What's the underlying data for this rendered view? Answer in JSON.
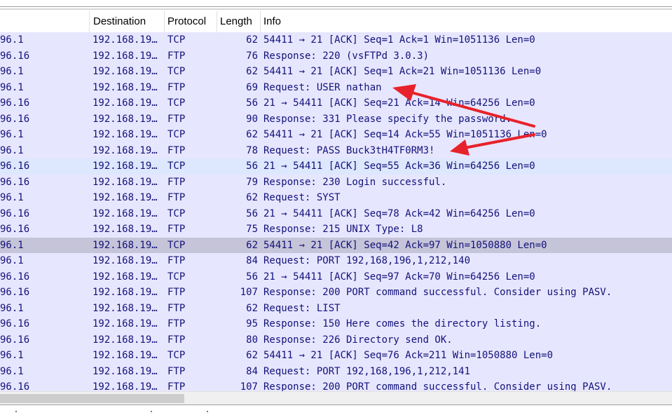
{
  "columns": {
    "destination": "Destination",
    "protocol": "Protocol",
    "length": "Length",
    "info": "Info"
  },
  "packets": [
    {
      "src": "96.1",
      "dst": "192.168.19…",
      "proto": "TCP",
      "len": "62",
      "info": "54411 → 21 [ACK] Seq=1 Ack=1 Win=1051136 Len=0"
    },
    {
      "src": "96.16",
      "dst": "192.168.19…",
      "proto": "FTP",
      "len": "76",
      "info": "Response: 220 (vsFTPd 3.0.3)"
    },
    {
      "src": "96.1",
      "dst": "192.168.19…",
      "proto": "TCP",
      "len": "62",
      "info": "54411 → 21 [ACK] Seq=1 Ack=21 Win=1051136 Len=0"
    },
    {
      "src": "96.1",
      "dst": "192.168.19…",
      "proto": "FTP",
      "len": "69",
      "info": "Request: USER nathan"
    },
    {
      "src": "96.16",
      "dst": "192.168.19…",
      "proto": "TCP",
      "len": "56",
      "info": "21 → 54411 [ACK] Seq=21 Ack=14 Win=64256 Len=0"
    },
    {
      "src": "96.16",
      "dst": "192.168.19…",
      "proto": "FTP",
      "len": "90",
      "info": "Response: 331 Please specify the password."
    },
    {
      "src": "96.1",
      "dst": "192.168.19…",
      "proto": "TCP",
      "len": "62",
      "info": "54411 → 21 [ACK] Seq=14 Ack=55 Win=1051136 Len=0"
    },
    {
      "src": "96.1",
      "dst": "192.168.19…",
      "proto": "FTP",
      "len": "78",
      "info": "Request: PASS Buck3tH4TF0RM3!"
    },
    {
      "src": "96.16",
      "dst": "192.168.19…",
      "proto": "TCP",
      "len": "56",
      "info": "21 → 54411 [ACK] Seq=55 Ack=36 Win=64256 Len=0",
      "highlight": "blue"
    },
    {
      "src": "96.16",
      "dst": "192.168.19…",
      "proto": "FTP",
      "len": "79",
      "info": "Response: 230 Login successful."
    },
    {
      "src": "96.1",
      "dst": "192.168.19…",
      "proto": "FTP",
      "len": "62",
      "info": "Request: SYST"
    },
    {
      "src": "96.16",
      "dst": "192.168.19…",
      "proto": "TCP",
      "len": "56",
      "info": "21 → 54411 [ACK] Seq=78 Ack=42 Win=64256 Len=0"
    },
    {
      "src": "96.16",
      "dst": "192.168.19…",
      "proto": "FTP",
      "len": "75",
      "info": "Response: 215 UNIX Type: L8"
    },
    {
      "src": "96.1",
      "dst": "192.168.19…",
      "proto": "TCP",
      "len": "62",
      "info": "54411 → 21 [ACK] Seq=42 Ack=97 Win=1050880 Len=0",
      "highlight": "gray"
    },
    {
      "src": "96.1",
      "dst": "192.168.19…",
      "proto": "FTP",
      "len": "84",
      "info": "Request: PORT 192,168,196,1,212,140"
    },
    {
      "src": "96.16",
      "dst": "192.168.19…",
      "proto": "TCP",
      "len": "56",
      "info": "21 → 54411 [ACK] Seq=97 Ack=70 Win=64256 Len=0"
    },
    {
      "src": "96.16",
      "dst": "192.168.19…",
      "proto": "FTP",
      "len": "107",
      "info": "Response: 200 PORT command successful. Consider using PASV."
    },
    {
      "src": "96.1",
      "dst": "192.168.19…",
      "proto": "FTP",
      "len": "62",
      "info": "Request: LIST"
    },
    {
      "src": "96.16",
      "dst": "192.168.19…",
      "proto": "FTP",
      "len": "95",
      "info": "Response: 150 Here comes the directory listing."
    },
    {
      "src": "96.16",
      "dst": "192.168.19…",
      "proto": "FTP",
      "len": "80",
      "info": "Response: 226 Directory send OK."
    },
    {
      "src": "96.1",
      "dst": "192.168.19…",
      "proto": "TCP",
      "len": "62",
      "info": "54411 → 21 [ACK] Seq=76 Ack=211 Win=1050880 Len=0"
    },
    {
      "src": "96.1",
      "dst": "192.168.19…",
      "proto": "FTP",
      "len": "84",
      "info": "Request: PORT 192,168,196,1,212,141"
    },
    {
      "src": "96.16",
      "dst": "192.168.19…",
      "proto": "FTP",
      "len": "107",
      "info": "Response: 200 PORT command successful. Consider using PASV."
    }
  ],
  "colors": {
    "row_background": "#e7e6ff",
    "row_text": "#12127a",
    "selected_blue": "#dde7fd",
    "selected_gray": "#c6c4d8",
    "annotation_arrow": "#e8222a"
  }
}
